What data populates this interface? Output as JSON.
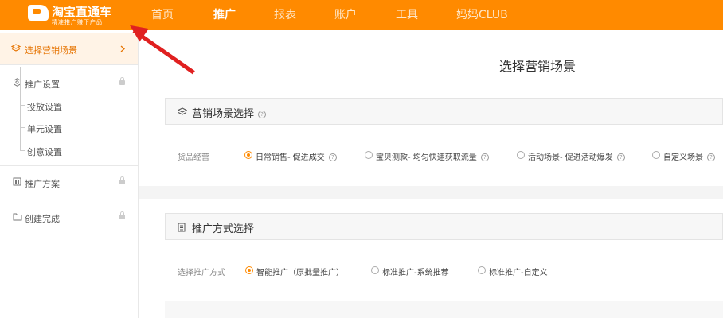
{
  "header": {
    "logo_title": "淘宝直通车",
    "logo_sub": "精准推广赚下产品",
    "nav": [
      "首页",
      "推广",
      "报表",
      "账户",
      "工具",
      "妈妈CLUB"
    ],
    "active_nav": "推广"
  },
  "sidebar": {
    "selected": "选择营销场景",
    "step2": "推广设置",
    "sub": [
      "投放设置",
      "单元设置",
      "创意设置"
    ],
    "step3": "推广方案",
    "step4": "创建完成"
  },
  "main": {
    "page_title": "选择营销场景",
    "scene_section": {
      "title": "营销场景选择",
      "label": "货品经营",
      "options": [
        "日常销售- 促进成交",
        "宝贝测款- 均匀快速获取流量",
        "活动场景- 促进活动爆发",
        "自定义场景"
      ],
      "selected_index": 0
    },
    "method_section": {
      "title": "推广方式选择",
      "label": "选择推广方式",
      "options": [
        "智能推广（原批量推广）",
        "标准推广-系统推荐",
        "标准推广-自定义"
      ],
      "selected_index": 0
    }
  },
  "colors": {
    "brand": "#ff8a00",
    "arrow": "#e02020"
  },
  "icons": [
    "layers-icon",
    "gear-icon",
    "lock-icon",
    "plan-icon",
    "folder-icon",
    "document-icon",
    "help-icon",
    "chevron-right-icon"
  ]
}
